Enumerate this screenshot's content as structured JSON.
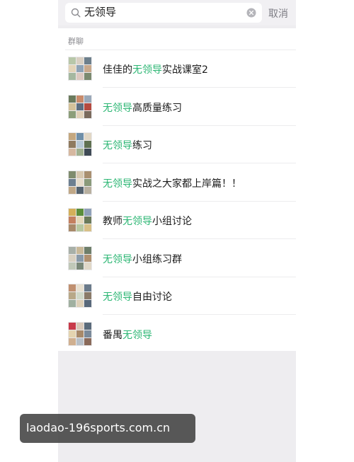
{
  "search": {
    "value": "无领导",
    "cancel_label": "取消"
  },
  "section": {
    "header": "群聊"
  },
  "groups": [
    {
      "before": "佳佳的",
      "match": "无领导",
      "after": "实战课室2"
    },
    {
      "before": "",
      "match": "无领导",
      "after": "高质量练习"
    },
    {
      "before": "",
      "match": "无领导",
      "after": "练习"
    },
    {
      "before": "",
      "match": "无领导",
      "after": "实战之大家都上岸篇！！"
    },
    {
      "before": "教师",
      "match": "无领导",
      "after": "小组讨论"
    },
    {
      "before": "",
      "match": "无领导",
      "after": "小组练习群"
    },
    {
      "before": "",
      "match": "无领导",
      "after": "自由讨论"
    },
    {
      "before": "番禺",
      "match": "无领导",
      "after": ""
    }
  ],
  "watermark": {
    "text": "laodao-196sports.com.cn"
  },
  "colors": {
    "highlight": "#2bb673",
    "background": "#eeedf0"
  }
}
